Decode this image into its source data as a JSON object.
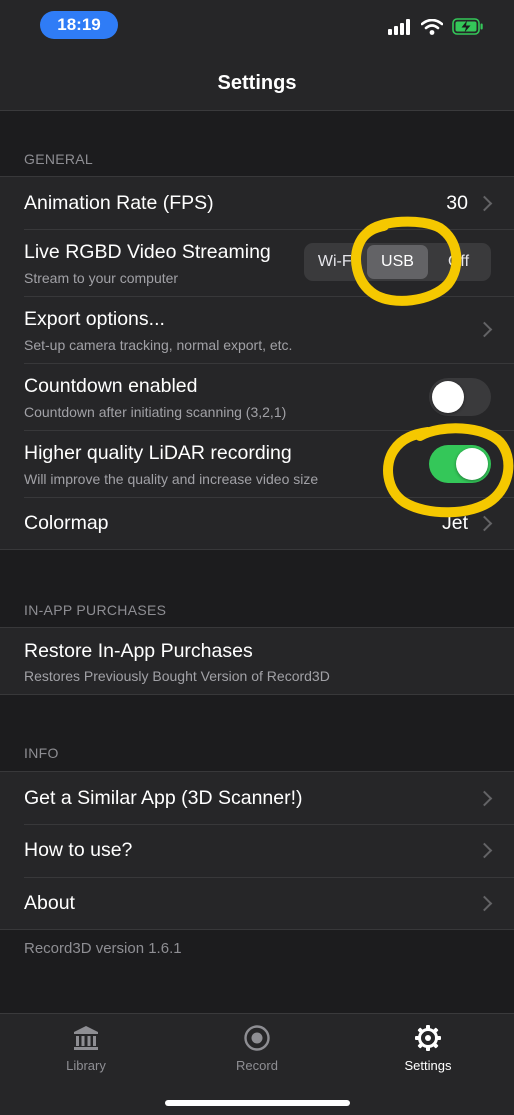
{
  "status": {
    "time": "18:19"
  },
  "nav": {
    "title": "Settings"
  },
  "general": {
    "header": "GENERAL",
    "animation_rate": {
      "title": "Animation Rate (FPS)",
      "value": "30"
    },
    "streaming": {
      "title": "Live RGBD Video Streaming",
      "subtitle": "Stream to your computer",
      "options": [
        "Wi-Fi",
        "USB",
        "Off"
      ],
      "selected": "USB"
    },
    "export": {
      "title": "Export options...",
      "subtitle": "Set-up camera tracking, normal export, etc."
    },
    "countdown": {
      "title": "Countdown enabled",
      "subtitle": "Countdown after initiating scanning (3,2,1)",
      "enabled": false
    },
    "lidar": {
      "title": "Higher quality LiDAR recording",
      "subtitle": "Will improve the quality and increase video size",
      "enabled": true
    },
    "colormap": {
      "title": "Colormap",
      "value": "Jet"
    }
  },
  "iap": {
    "header": "IN-APP PURCHASES",
    "restore": {
      "title": "Restore In-App Purchases",
      "subtitle": "Restores Previously Bought Version of Record3D"
    }
  },
  "info": {
    "header": "INFO",
    "similar_app": "Get a Similar App (3D Scanner!)",
    "how_to": "How to use?",
    "about": "About",
    "version": "Record3D version 1.6.1"
  },
  "tabs": {
    "library": "Library",
    "record": "Record",
    "settings": "Settings"
  },
  "colors": {
    "accent_green": "#34c759",
    "time_pill": "#2f7cf6",
    "annotation_yellow": "#f5c800"
  },
  "icons": [
    "signal-icon",
    "wifi-icon",
    "battery-charging-icon",
    "chevron-right-icon",
    "library-icon",
    "record-icon",
    "settings-gear-icon"
  ]
}
